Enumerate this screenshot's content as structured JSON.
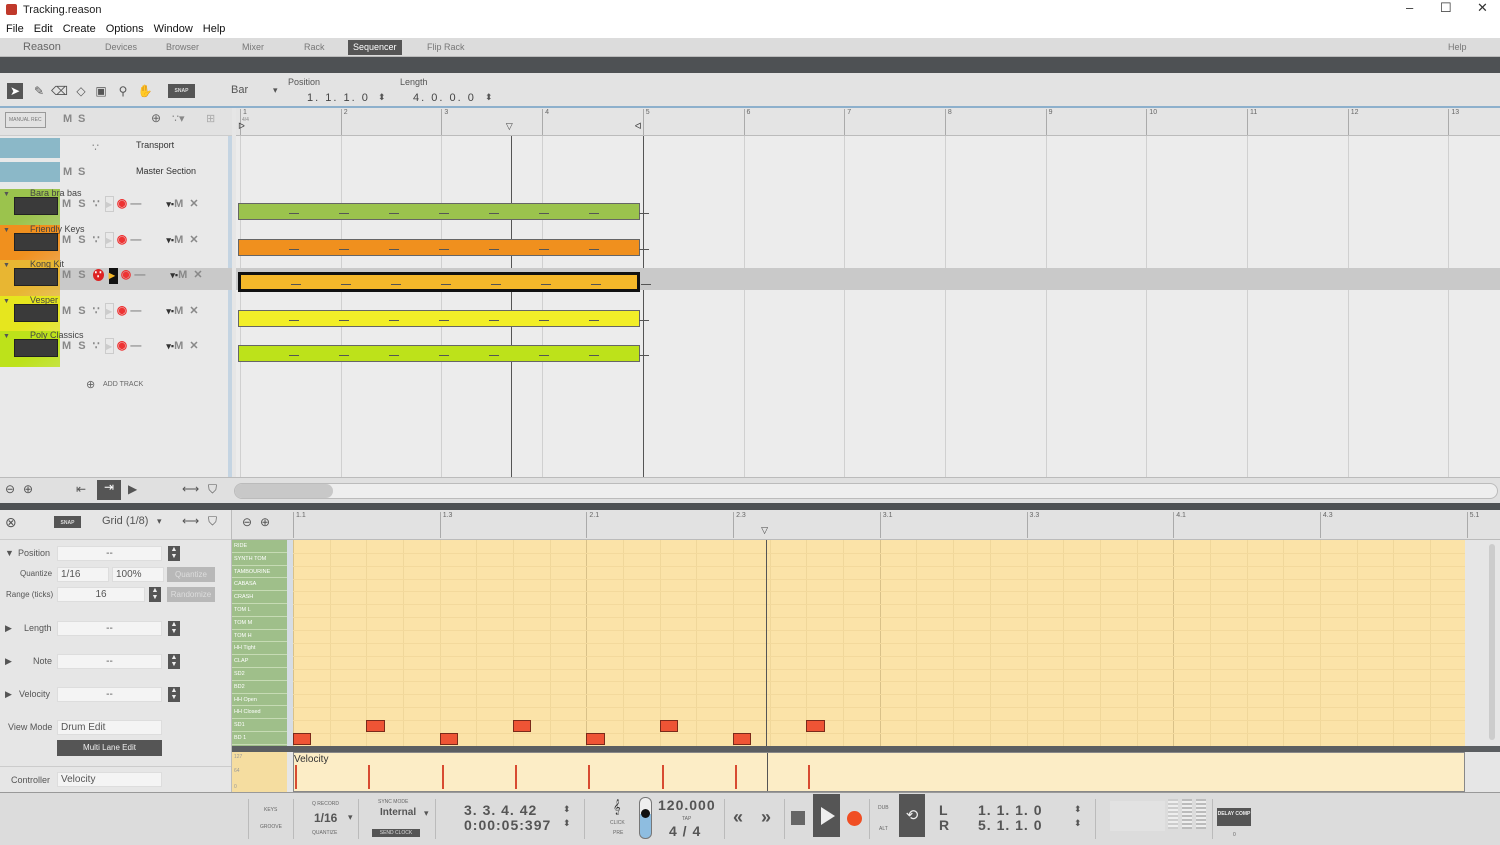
{
  "window": {
    "title": "Tracking.reason",
    "minimize": "–",
    "maximize": "☐",
    "close": "✕"
  },
  "menu": [
    "File",
    "Edit",
    "Create",
    "Options",
    "Window",
    "Help"
  ],
  "tabs": {
    "logo": "Reason",
    "items": [
      "Devices",
      "Browser",
      "Mixer",
      "Rack",
      "Sequencer",
      "Flip Rack"
    ],
    "active": "Sequencer",
    "help": "Help"
  },
  "toolbar": {
    "snap": "SNAP",
    "snap_value": "Bar",
    "position_label": "Position",
    "position": "1. 1. 1.  0",
    "length_label": "Length",
    "length": "4. 0. 0.  0"
  },
  "track_header": {
    "manual_rec": "MANUAL REC",
    "m": "M",
    "s": "S"
  },
  "ruler": [
    "1",
    "2",
    "3",
    "4",
    "5",
    "6",
    "7",
    "8",
    "9",
    "10",
    "11",
    "12",
    "13"
  ],
  "time_sig": "4/4",
  "fixed_tracks": [
    {
      "name": "Transport"
    },
    {
      "name": "Master Section"
    }
  ],
  "tracks": [
    {
      "name": "Bara bra bas",
      "color": "#9bc34d",
      "clip": "#9bc34d"
    },
    {
      "name": "Friendly Keys",
      "color": "#f0901e",
      "clip": "#f0901e"
    },
    {
      "name": "Kong Kit",
      "color": "#e8b632",
      "clip": "#f5b82a",
      "selected": true
    },
    {
      "name": "Vesper",
      "color": "#e6e61e",
      "clip": "#f2ee28"
    },
    {
      "name": "Poly Classics",
      "color": "#bde21a",
      "clip": "#bde21a"
    }
  ],
  "add_track": "ADD TRACK",
  "editor": {
    "snap": "SNAP",
    "grid": "Grid (1/8)",
    "ruler": [
      "1.1",
      "1.3",
      "2.1",
      "2.3",
      "3.1",
      "3.3",
      "4.1",
      "4.3",
      "5.1"
    ],
    "lanes": [
      "RIDE",
      "SYNTH TOM",
      "TAMBOURINE",
      "CABASA",
      "CRASH",
      "TOM L",
      "TOM M",
      "TOM H",
      "HH Tight",
      "CLAP",
      "SD2",
      "BD2",
      "HH Open",
      "HH Closed",
      "SD1",
      "BD 1"
    ],
    "notes": [
      {
        "lane": "BD 1",
        "pos16": 0
      },
      {
        "lane": "SD1",
        "pos16": 4
      },
      {
        "lane": "BD 1",
        "pos16": 8
      },
      {
        "lane": "SD1",
        "pos16": 12
      },
      {
        "lane": "BD 1",
        "pos16": 16
      },
      {
        "lane": "SD1",
        "pos16": 20
      },
      {
        "lane": "BD 1",
        "pos16": 24
      },
      {
        "lane": "SD1",
        "pos16": 28
      }
    ],
    "velocity_label": "Velocity",
    "velocity_scale": [
      "127",
      "64",
      "0"
    ],
    "velocities": [
      100,
      100,
      100,
      100,
      100,
      100,
      100,
      100
    ]
  },
  "inspector": {
    "position": "Position",
    "position_value": "--",
    "quantize_label": "Quantize",
    "quantize": "1/16",
    "quantize_pct": "100%",
    "quantize_btn": "Quantize",
    "range_label": "Range (ticks)",
    "range": "16",
    "randomize": "Randomize",
    "length": "Length",
    "length_value": "--",
    "note": "Note",
    "note_value": "--",
    "velocity": "Velocity",
    "velocity_value": "--",
    "view_mode_label": "View Mode",
    "view_mode": "Drum Edit",
    "multi_lane": "Multi Lane Edit",
    "controller_label": "Controller",
    "controller": "Velocity"
  },
  "transport": {
    "keys": "KEYS",
    "groove": "GROOVE",
    "qrecord": "Q RECORD",
    "qvalue": "1/16",
    "quantize": "QUANTIZE",
    "sync_label": "SYNC MODE",
    "sync": "Internal",
    "send_clock": "SEND CLOCK",
    "bars": "3. 3. 4. 42",
    "time": "0:00:05:397",
    "click": "CLICK",
    "pre": "PRE",
    "tempo": "120.000",
    "tap": "TAP",
    "signature": "4 / 4",
    "dub": "DUB",
    "alt": "ALT",
    "l": "L",
    "r": "R",
    "lpos": "1. 1. 1.   0",
    "rpos": "5. 1. 1.   0",
    "delay_comp": "DELAY COMP",
    "delay_value": "0"
  },
  "playhead": {
    "arrange_bar": 3.69,
    "editor_pos16": 25.8
  },
  "colors": {
    "accent": "#ee5435",
    "dark": "#4e5154"
  }
}
